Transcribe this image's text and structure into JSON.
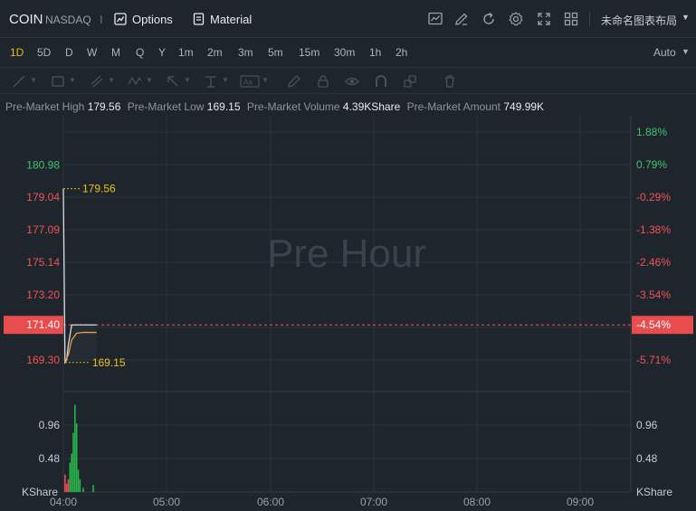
{
  "header": {
    "ticker": "COIN",
    "exchange": "NASDAQ",
    "separator": "I",
    "options_label": "Options",
    "material_label": "Material",
    "layout_label": "未命名图表布局",
    "toolbar_icons": [
      "chart-icon",
      "edit-icon",
      "refresh-icon",
      "settings-icon",
      "fullscreen-icon",
      "grid-layout-icon"
    ]
  },
  "periods": {
    "items": [
      "1D",
      "5D",
      "D",
      "W",
      "M",
      "Q",
      "Y",
      "1m",
      "2m",
      "3m",
      "5m",
      "15m",
      "30m",
      "1h",
      "2h"
    ],
    "active": "1D",
    "scale_mode": "Auto"
  },
  "stats": {
    "high_label": "Pre-Market High",
    "high_value": "179.56",
    "low_label": "Pre-Market Low",
    "low_value": "169.15",
    "volume_label": "Pre-Market Volume",
    "volume_value": "4.39KShare",
    "amount_label": "Pre-Market Amount",
    "amount_value": "749.99K"
  },
  "chart_data": {
    "type": "line",
    "watermark": "Pre Hour",
    "x_ticks": [
      "04:00",
      "05:00",
      "06:00",
      "07:00",
      "08:00",
      "09:00"
    ],
    "price_ticks": [
      "180.98",
      "179.04",
      "177.09",
      "175.14",
      "173.20",
      "169.30"
    ],
    "price_tick_values": [
      180.98,
      179.04,
      177.09,
      175.14,
      173.2,
      169.3
    ],
    "percent_ticks": [
      "1.88%",
      "0.79%",
      "-0.29%",
      "-1.38%",
      "-2.46%",
      "-3.54%",
      "-5.71%"
    ],
    "percent_tick_values": [
      1.88,
      0.79,
      -0.29,
      -1.38,
      -2.46,
      -3.54,
      -5.71
    ],
    "current_price": "171.40",
    "current_price_value": 171.4,
    "current_change": "-4.54%",
    "high_label": "179.56",
    "high_value": 179.56,
    "low_label": "169.15",
    "low_value": 169.15,
    "price_series": {
      "minutes": [
        0,
        1,
        2,
        3,
        5,
        8,
        10,
        12,
        15,
        18,
        20
      ],
      "prices": [
        179.56,
        169.15,
        169.3,
        170.2,
        171.4,
        171.4,
        171.4,
        171.4,
        171.4,
        171.4,
        171.4
      ]
    },
    "avg_series": {
      "minutes": [
        1,
        3,
        5,
        8,
        12,
        15,
        20
      ],
      "prices": [
        169.2,
        169.6,
        170.5,
        170.9,
        170.95,
        170.95,
        170.95
      ]
    },
    "volume_ticks": [
      "0.96",
      "0.48"
    ],
    "volume_tick_values": [
      0.96,
      0.48
    ],
    "volume_unit": "KShare",
    "volume_bars": [
      {
        "minute": 1,
        "value": 0.25,
        "color": "#e84c4c"
      },
      {
        "minute": 2,
        "value": 0.12,
        "color": "#e84c4c"
      },
      {
        "minute": 3,
        "value": 0.18,
        "color": "#e84c4c"
      },
      {
        "minute": 4,
        "value": 0.42,
        "color": "#27b34a"
      },
      {
        "minute": 5,
        "value": 0.55,
        "color": "#27b34a"
      },
      {
        "minute": 6,
        "value": 0.85,
        "color": "#27b34a"
      },
      {
        "minute": 7,
        "value": 1.25,
        "color": "#27b34a"
      },
      {
        "minute": 8,
        "value": 0.98,
        "color": "#27b34a"
      },
      {
        "minute": 9,
        "value": 0.32,
        "color": "#27b34a"
      },
      {
        "minute": 10,
        "value": 0.18,
        "color": "#27b34a"
      },
      {
        "minute": 12,
        "value": 0.06,
        "color": "#27b34a"
      },
      {
        "minute": 18,
        "value": 0.1,
        "color": "#27b34a"
      }
    ],
    "colors": {
      "up": "#3ec46d",
      "down": "#f05454",
      "line": "#d8dbe0",
      "avg": "#e8a23a",
      "hl_marker": "#e8c21a",
      "current_bg": "#e84c4c"
    }
  }
}
